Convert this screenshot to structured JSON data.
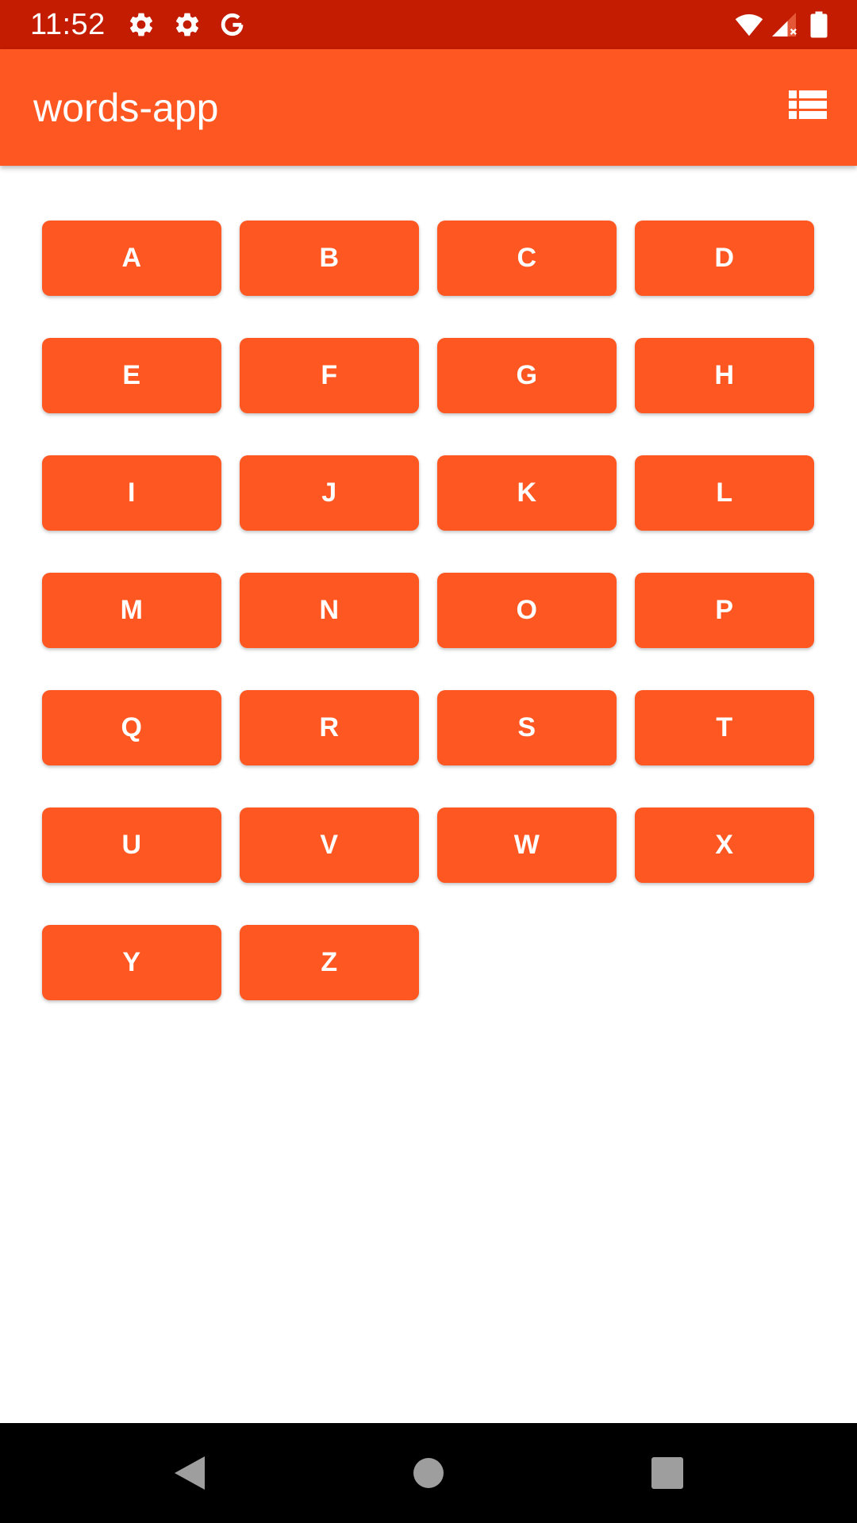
{
  "status_bar": {
    "time": "11:52",
    "icons": [
      "settings-icon",
      "settings-icon",
      "google-icon",
      "wifi-icon",
      "signal-icon",
      "battery-icon"
    ]
  },
  "app_bar": {
    "title": "words-app",
    "action_icon": "grid-layout-icon"
  },
  "letters": [
    "A",
    "B",
    "C",
    "D",
    "E",
    "F",
    "G",
    "H",
    "I",
    "J",
    "K",
    "L",
    "M",
    "N",
    "O",
    "P",
    "Q",
    "R",
    "S",
    "T",
    "U",
    "V",
    "W",
    "X",
    "Y",
    "Z"
  ],
  "nav_bar": {
    "icons": [
      "back-icon",
      "home-icon",
      "recents-icon"
    ]
  },
  "colors": {
    "status_bar": "#c41c00",
    "primary": "#ff5722",
    "on_primary": "#ffffff",
    "nav_bar": "#000000",
    "nav_icon": "#9e9e9e"
  }
}
